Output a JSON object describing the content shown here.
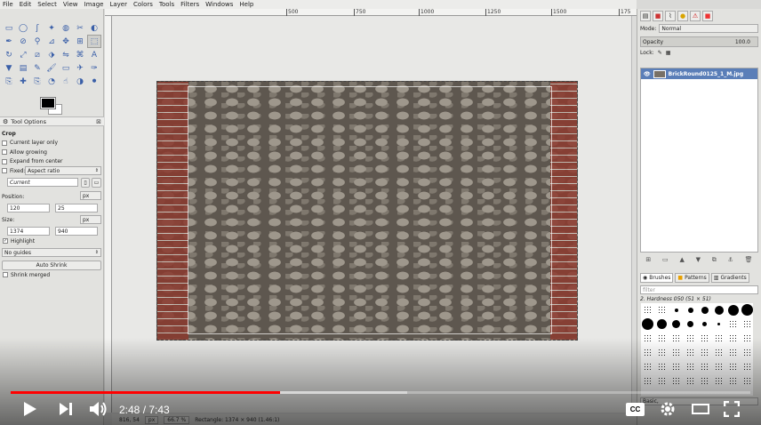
{
  "menubar": {
    "items": [
      "File",
      "Edit",
      "Select",
      "View",
      "Image",
      "Layer",
      "Colors",
      "Tools",
      "Filters",
      "Windows",
      "Help"
    ]
  },
  "ruler": {
    "ticks": [
      "500",
      "750",
      "1000",
      "1250",
      "1500",
      "175"
    ]
  },
  "toolbox": {
    "tools": [
      "rect-select",
      "ellipse-select",
      "free-select",
      "fuzzy-select",
      "color-select",
      "scissors-select",
      "foreground-select",
      "paths",
      "color-picker",
      "zoom",
      "measure",
      "move",
      "align",
      "crop",
      "rotate",
      "scale",
      "shear",
      "perspective",
      "flip",
      "cage",
      "text",
      "bucket-fill",
      "blend",
      "pencil",
      "paintbrush",
      "eraser",
      "airbrush",
      "ink",
      "clone",
      "heal",
      "perspective-clone",
      "blur",
      "smudge",
      "dodge-burn",
      "mypaint"
    ]
  },
  "tool_options": {
    "tab_label": "Tool Options",
    "section_title": "Crop",
    "current_layer_only": "Current layer only",
    "allow_growing": "Allow growing",
    "expand_from_center": "Expand from center",
    "fixed_label": "Fixed:",
    "fixed_value": "Aspect ratio",
    "current_value": "Current",
    "position_label": "Position:",
    "position_unit": "px",
    "position_x": "120",
    "position_y": "25",
    "size_label": "Size:",
    "size_unit": "px",
    "size_w": "1374",
    "size_h": "940",
    "highlight": "Highlight",
    "guides": "No guides",
    "auto_shrink": "Auto Shrink",
    "shrink_merged": "Shrink merged"
  },
  "layers": {
    "mode_label": "Mode:",
    "mode_value": "Normal",
    "opacity_label": "Opacity",
    "opacity_value": "100.0",
    "lock_label": "Lock:",
    "layer_name": "BrickRound0125_1_M.jpg"
  },
  "brushes": {
    "tabs": [
      "Brushes",
      "Patterns",
      "Gradients"
    ],
    "filter_placeholder": "filter",
    "selected": "2. Hardness 050 (51 × 51)",
    "preset": "Basic,"
  },
  "status": {
    "coords": "816, 54",
    "unit": "px",
    "zoom": "66.7 %",
    "message": "Rectangle: 1374 × 940  (1.46:1)"
  },
  "video": {
    "time": "2:48 / 7:43",
    "progress": 0.364,
    "buffered": 0.536,
    "cc_label": "CC",
    "colors": {
      "played": "#ff0000"
    }
  }
}
